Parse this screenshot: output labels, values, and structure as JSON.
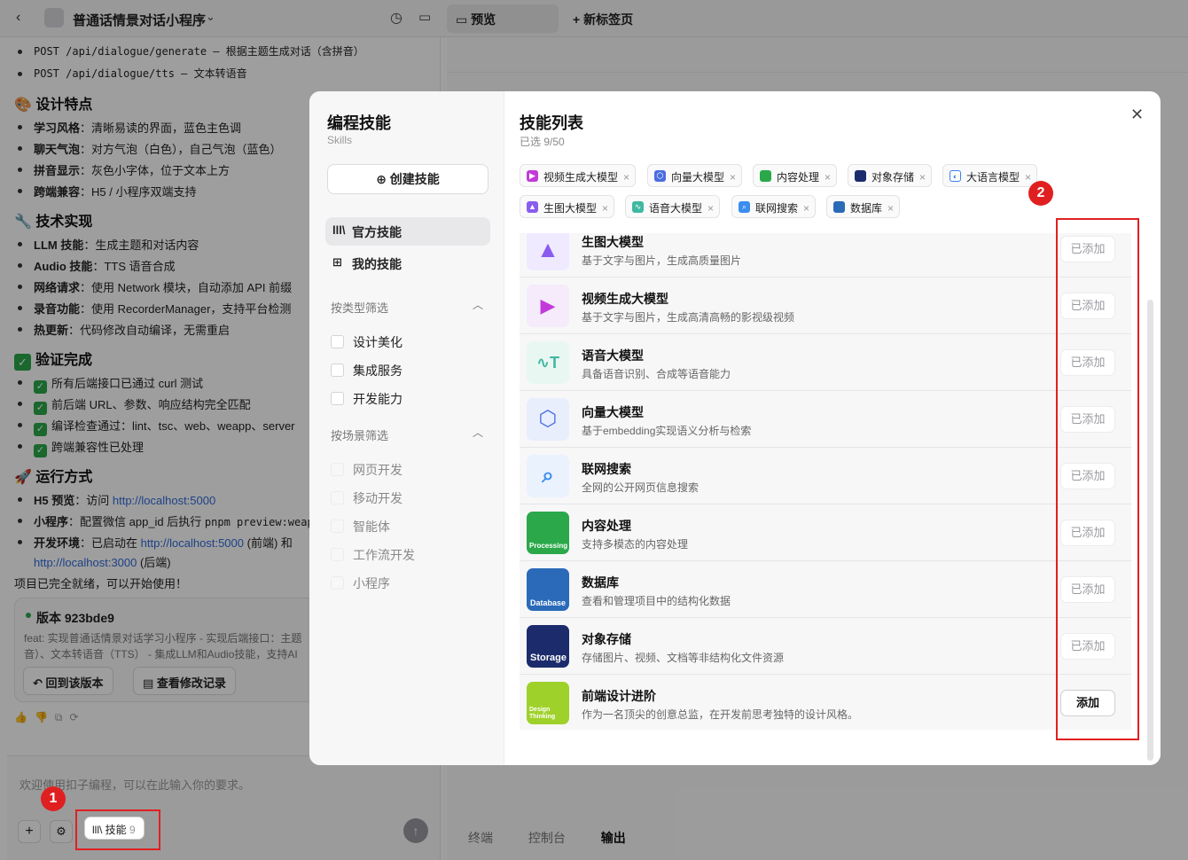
{
  "topbar": {
    "back": "‹",
    "app_title": "普通话情景对话小程序",
    "chevron": "⌄",
    "history_icon": "◷",
    "folder_icon": "▭",
    "tab_preview": "▭ 预览",
    "tab_new": "+ 新标签页"
  },
  "chat": {
    "api1": "POST /api/dialogue/generate – 根据主题生成对话（含拼音）",
    "api2": "POST /api/dialogue/tts – 文本转语音",
    "design_title": "🎨 设计特点",
    "design": [
      {
        "k": "学习风格",
        "v": "：清晰易读的界面，蓝色主色调"
      },
      {
        "k": "聊天气泡",
        "v": "：对方气泡（白色），自己气泡（蓝色）"
      },
      {
        "k": "拼音显示",
        "v": "：灰色小字体，位于文本上方"
      },
      {
        "k": "跨端兼容",
        "v": "：H5 / 小程序双端支持"
      }
    ],
    "tech_title": "🔧 技术实现",
    "tech": [
      {
        "k": "LLM 技能",
        "v": "：生成主题和对话内容"
      },
      {
        "k": "Audio 技能",
        "v": "：TTS 语音合成"
      },
      {
        "k": "网络请求",
        "v": "：使用 Network 模块，自动添加 API 前缀"
      },
      {
        "k": "录音功能",
        "v": "：使用 RecorderManager，支持平台检测"
      },
      {
        "k": "热更新",
        "v": "：代码修改自动编译，无需重启"
      }
    ],
    "verify_title": "验证完成",
    "verify": [
      "所有后端接口已通过 curl 测试",
      "前后端 URL、参数、响应结构完全匹配",
      "编译检查通过：lint、tsc、web、weapp、server",
      "跨端兼容性已处理"
    ],
    "run_title": "🚀 运行方式",
    "run1_k": "H5 预览",
    "run1_v": "：访问 ",
    "run1_link": "http://localhost:5000",
    "run2_k": "小程序",
    "run2_v": "：配置微信 app_id 后执行 ",
    "run2_code": "pnpm preview:weapp",
    "run3_k": "开发环境",
    "run3_v": "：已启动在 ",
    "run3_link1": "http://localhost:5000",
    "run3_mid": " (前端) 和",
    "run3_link2": "http://localhost:3000",
    "run3_end": " (后端)",
    "done": "项目已完全就绪，可以开始使用！",
    "version_title": "版本 923bde9",
    "version_desc1": "feat: 实现普通话情景对话学习小程序 - 实现后端接口：主题",
    "version_desc2": "音）、文本转语音（TTS） - 集成LLM和Audio技能，支持AI",
    "btn_revert": "↶ 回到该版本",
    "btn_changes": "▤ 查看修改记录",
    "reactions": "👍👎⧉⟳",
    "input_placeholder": "欢迎使用扣子编程，可以在此输入你的要求。",
    "plus": "+",
    "settings_icon": "⚙",
    "skill_btn": "lll\\ 技能",
    "skill_count": "9",
    "send": "↑"
  },
  "bottom_tabs": [
    "终端",
    "控制台",
    "输出"
  ],
  "modal": {
    "side_title": "编程技能",
    "side_sub": "Skills",
    "create": "⊕ 创建技能",
    "nav": [
      {
        "icon": "lll\\",
        "label": "官方技能"
      },
      {
        "icon": "⊞",
        "label": "我的技能"
      }
    ],
    "filter_type_title": "按类型筛选",
    "filter_type": [
      "设计美化",
      "集成服务",
      "开发能力"
    ],
    "filter_scene_title": "按场景筛选",
    "filter_scene": [
      "网页开发",
      "移动开发",
      "智能体",
      "工作流开发",
      "小程序"
    ],
    "main_title": "技能列表",
    "selected": "已选 9/50",
    "close": "✕",
    "tags": [
      {
        "label": "视频生成大模型",
        "color": "#c23bd8"
      },
      {
        "label": "向量大模型",
        "color": "#4a6ee0"
      },
      {
        "label": "内容处理",
        "color": "#2aa84a"
      },
      {
        "label": "对象存储",
        "color": "#1c2b6b"
      },
      {
        "label": "大语言模型",
        "color": "#3b7df0"
      },
      {
        "label": "生图大模型",
        "color": "#8a5cf0"
      },
      {
        "label": "语音大模型",
        "color": "#3fb8a0"
      },
      {
        "label": "联网搜索",
        "color": "#3b8df0"
      },
      {
        "label": "数据库",
        "color": "#2a6ab8"
      }
    ],
    "tag_close": "×",
    "skills": [
      {
        "name": "生图大模型",
        "desc": "基于文字与图片，生成高质量图片",
        "btn": "已添加",
        "icon_text": "▲"
      },
      {
        "name": "视频生成大模型",
        "desc": "基于文字与图片，生成高清高畅的影视级视频",
        "btn": "已添加",
        "icon_text": "▶"
      },
      {
        "name": "语音大模型",
        "desc": "具备语音识别、合成等语音能力",
        "btn": "已添加",
        "icon_text": "∿T"
      },
      {
        "name": "向量大模型",
        "desc": "基于embedding实现语义分析与检索",
        "btn": "已添加",
        "icon_text": "⬡"
      },
      {
        "name": "联网搜索",
        "desc": "全网的公开网页信息搜索",
        "btn": "已添加",
        "icon_text": "⌕"
      },
      {
        "name": "内容处理",
        "desc": "支持多模态的内容处理",
        "btn": "已添加",
        "icon_text": "Processing"
      },
      {
        "name": "数据库",
        "desc": "查看和管理项目中的结构化数据",
        "btn": "已添加",
        "icon_text": "Database"
      },
      {
        "name": "对象存储",
        "desc": "存储图片、视频、文档等非结构化文件资源",
        "btn": "已添加",
        "icon_text": "Storage"
      },
      {
        "name": "前端设计进阶",
        "desc": "作为一名顶尖的创意总监，在开发前思考独特的设计风格。",
        "btn": "添加",
        "icon_text": "Design Thinking"
      }
    ]
  },
  "annotations": {
    "badge1": "1",
    "badge2": "2"
  }
}
